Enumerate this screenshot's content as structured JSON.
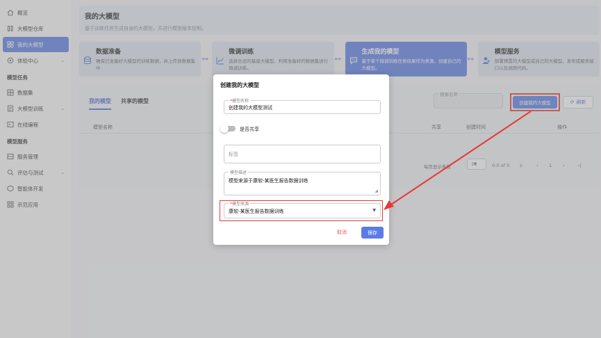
{
  "sidebar": {
    "items_top": [
      {
        "label": "概览",
        "icon": "home-icon"
      },
      {
        "label": "大模型仓库",
        "icon": "database-icon"
      },
      {
        "label": "我的大模型",
        "icon": "model-icon",
        "active": true
      },
      {
        "label": "体验中心",
        "icon": "experience-icon",
        "chevron": true
      }
    ],
    "section_tasks": "模型任务",
    "items_tasks": [
      {
        "label": "数据集",
        "icon": "dataset-icon"
      },
      {
        "label": "大模型训练",
        "icon": "training-icon",
        "chevron": true
      },
      {
        "label": "在线编程",
        "icon": "code-icon"
      }
    ],
    "section_services": "模型服务",
    "items_services": [
      {
        "label": "服务管理",
        "icon": "service-icon"
      },
      {
        "label": "评估与测试",
        "icon": "evaluate-icon",
        "chevron": true
      },
      {
        "label": "智能体开发",
        "icon": "agent-icon"
      },
      {
        "label": "示范应用",
        "icon": "apps-icon"
      }
    ]
  },
  "header": {
    "title": "我的大模型",
    "subtitle": "基于训练任务生成自身的大模型，并进行模型版本控制。"
  },
  "steps": [
    {
      "title": "数据准备",
      "desc": "确保已准备好大模型的训练数据，并上传到数据集中",
      "icon": "database-icon"
    },
    {
      "title": "微调训练",
      "desc": "选择合适的基座大模型，利用准备好的数据集进行微调训练。",
      "icon": "chart-icon"
    },
    {
      "title": "生成我的模型",
      "desc": "基于某个微调训练任务结果作为来源，创建自己的大模型。",
      "icon": "chat-icon",
      "active": true
    },
    {
      "title": "模型服务",
      "desc": "部署预置的大模型或自己的大模型，发布成服务接口以及调用代码。",
      "icon": "user-icon"
    }
  ],
  "tabs": [
    "我的模型",
    "共享的模型"
  ],
  "search_placeholder": "搜索名称",
  "create_button": "创建我的大模型",
  "refresh_button": "刷新",
  "table": {
    "columns": [
      "模型名称",
      "共享",
      "创建时间",
      "操作"
    ]
  },
  "pager": {
    "rows_per_page": "每页显示条数",
    "rows_value": "10",
    "range": "0-0 of 0",
    "page": "1"
  },
  "modal": {
    "title": "创建我的大模型",
    "name_label": "模型名称",
    "name_value": "创建我的大模型测试",
    "share_label": "是否共享",
    "tag_placeholder": "标签",
    "desc_label": "模型描述",
    "desc_value": "模型来源于康软-某医生报告数据训练",
    "source_label": "模型来源",
    "source_value": "康软-某医生报告数据训练",
    "cancel": "取消",
    "save": "保存"
  }
}
